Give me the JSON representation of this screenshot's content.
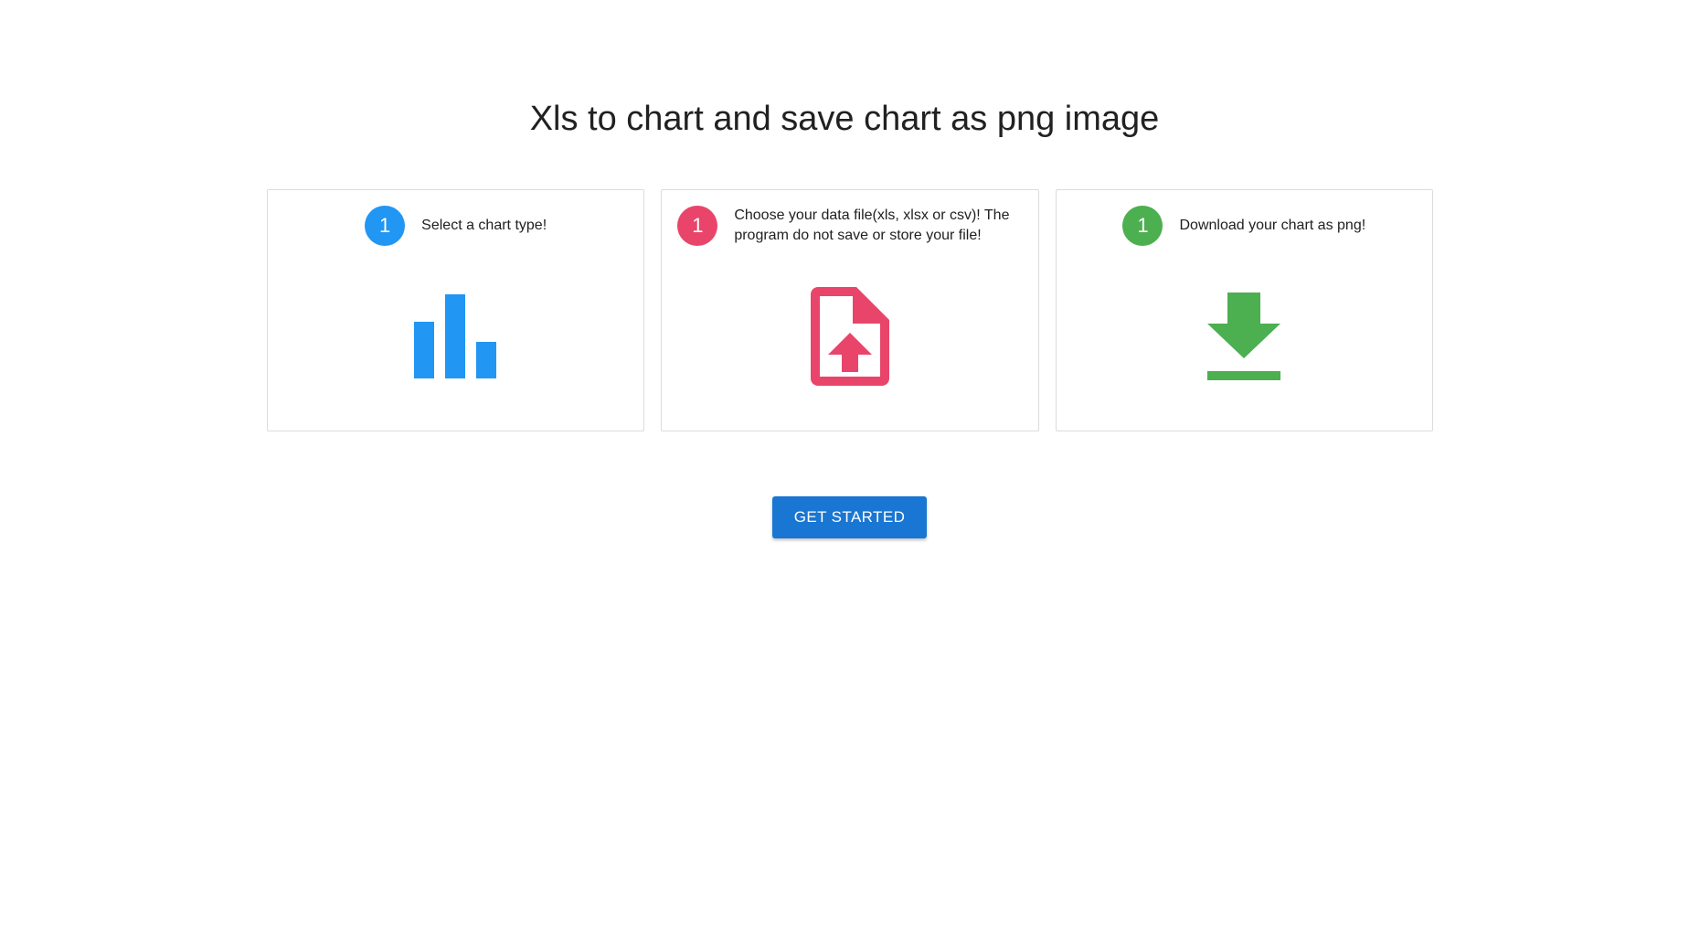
{
  "page": {
    "title": "Xls to chart and save chart as png image"
  },
  "steps": [
    {
      "number": "1",
      "text": "Select a chart type!",
      "color": "#2196f3",
      "icon": "bar-chart-icon"
    },
    {
      "number": "1",
      "text": "Choose your data file(xls, xlsx or csv)! The program do not save or store your file!",
      "color": "#e9456a",
      "icon": "file-upload-icon"
    },
    {
      "number": "1",
      "text": "Download your chart as png!",
      "color": "#4caf50",
      "icon": "download-icon"
    }
  ],
  "actions": {
    "get_started_label": "GET STARTED",
    "primary_color": "#1976d2"
  }
}
